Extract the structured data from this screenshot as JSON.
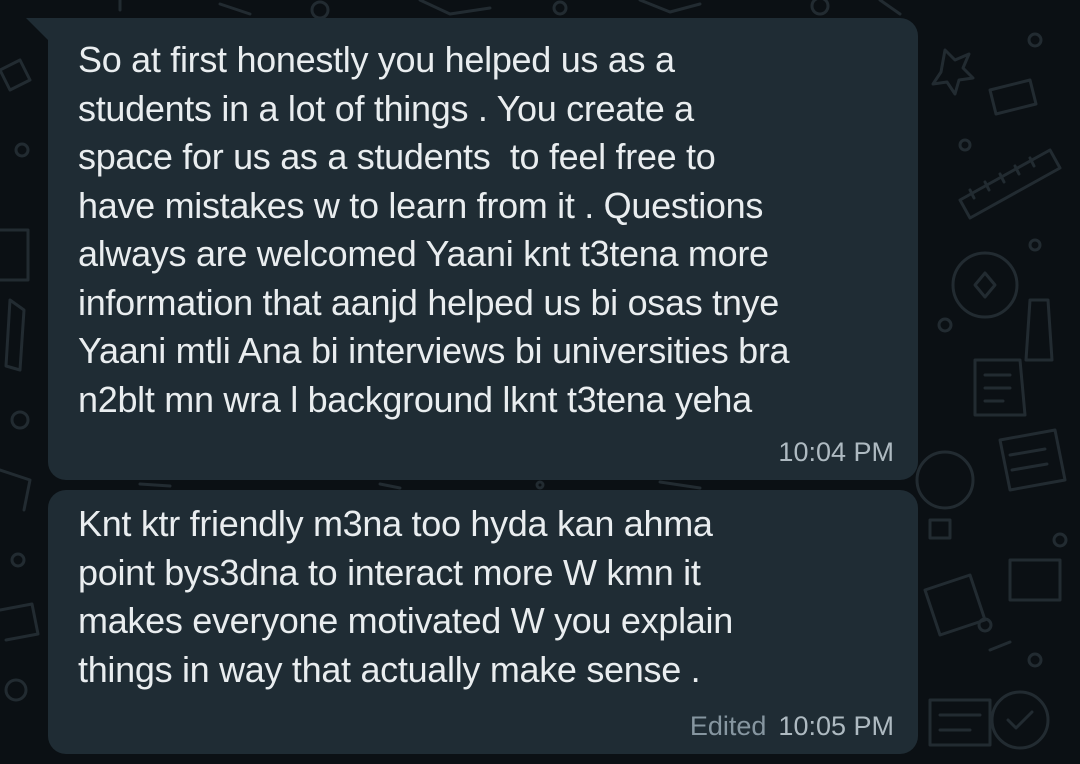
{
  "theme": {
    "background": "#0b1014",
    "bubble_color": "#1f2c34",
    "text_color": "#e9edef",
    "meta_color": "#8696a0"
  },
  "messages": [
    {
      "text": "So at first honestly you helped us as a\nstudents in a lot of things . You create a\nspace for us as a students  to feel free to\nhave mistakes w to learn from it . Questions\nalways are welcomed Yaani knt t3tena more\ninformation that aanjd helped us bi osas tnye\nYaani mtli Ana bi interviews bi universities bra\nn2blt mn wra l background lknt t3tena yeha",
      "time": "10:04 PM",
      "edited": ""
    },
    {
      "text": "Knt ktr friendly m3na too hyda kan ahma\npoint bys3dna to interact more W kmn it\nmakes everyone motivated W you explain\nthings in way that actually make sense .",
      "time": "10:05 PM",
      "edited": "Edited"
    }
  ]
}
